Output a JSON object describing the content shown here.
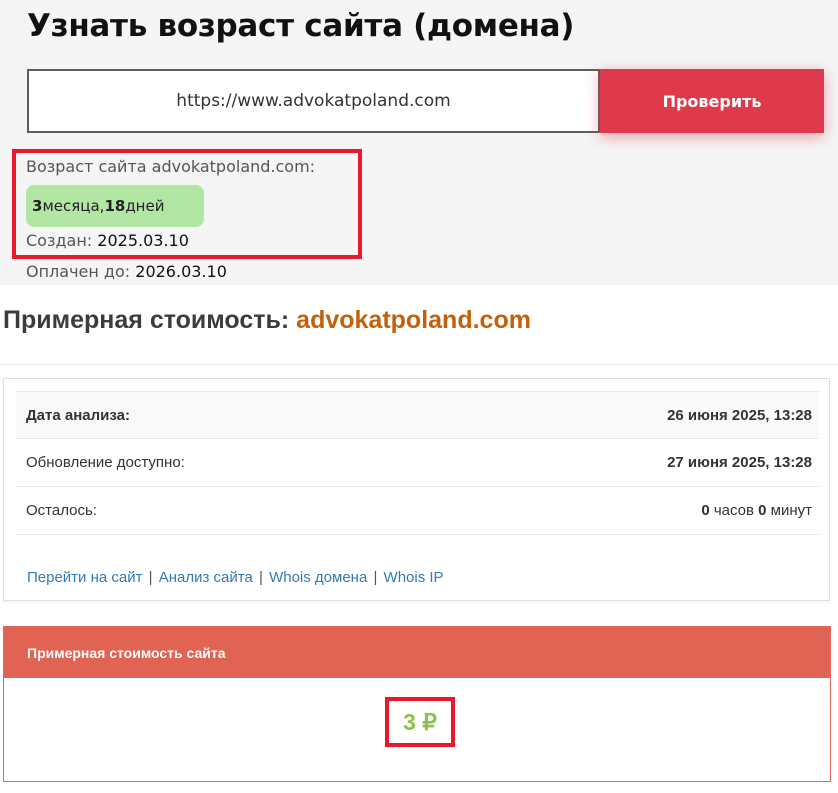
{
  "header": {
    "title": "Узнать возраст сайта (домена)"
  },
  "search": {
    "value": "https://www.advokatpoland.com",
    "button_label": "Проверить"
  },
  "result": {
    "age_label": "Возраст сайта advokatpoland.com:",
    "age_months_num": "3",
    "age_months_word": " месяца, ",
    "age_days_num": "18",
    "age_days_word": " дней",
    "created_label": "Создан: ",
    "created_value": "2025.03.10",
    "paid_label": "Оплачен до: ",
    "paid_value": "2026.03.10",
    "highlight_color": "#e8192c",
    "badge_color": "#b2e6a4"
  },
  "cost_section": {
    "heading_prefix": "Примерная стоимость: ",
    "heading_domain": "advokatpoland.com",
    "domain_color": "#c4600b"
  },
  "info_table": {
    "rows": [
      {
        "label": "Дата анализа:",
        "value_bold": "26 июня 2025, 13:28"
      },
      {
        "label": "Обновление доступно:",
        "value_bold": "27 июня 2025, 13:28"
      },
      {
        "label": "Осталось:",
        "v1": "0",
        "u1": " часов ",
        "v2": "0",
        "u2": " минут"
      }
    ],
    "links": [
      "Перейти на сайт",
      "Анализ сайта",
      "Whois домена",
      "Whois IP"
    ],
    "separator": "|"
  },
  "price_panel": {
    "header": "Примерная стоимость сайта",
    "value": "3 ₽",
    "header_color": "#e06353",
    "value_color": "#8bc34a"
  },
  "colors": {
    "button": "#de3a4b",
    "link": "#337ab7"
  }
}
